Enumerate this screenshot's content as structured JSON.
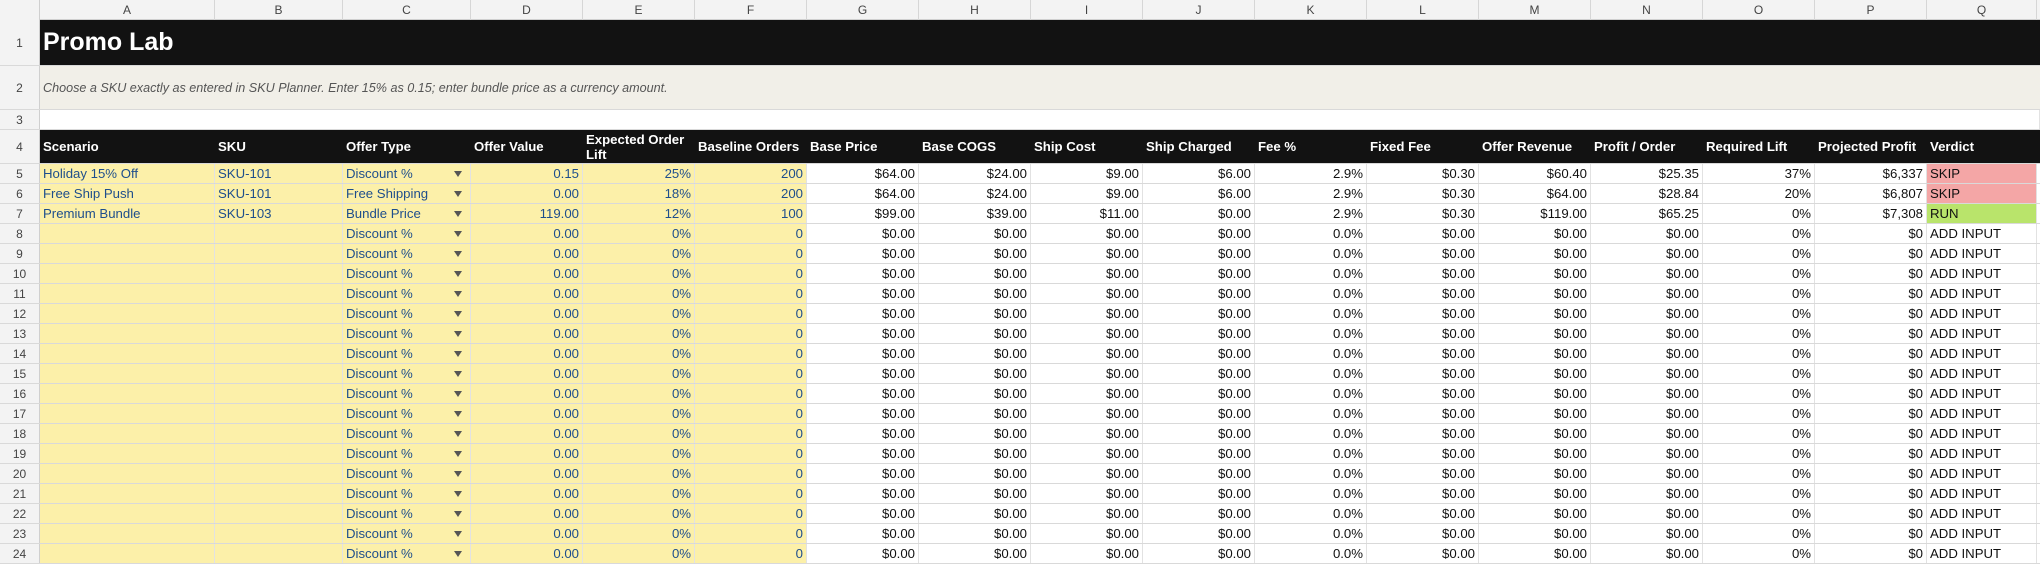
{
  "columns": [
    "A",
    "B",
    "C",
    "D",
    "E",
    "F",
    "G",
    "H",
    "I",
    "J",
    "K",
    "L",
    "M",
    "N",
    "O",
    "P",
    "Q"
  ],
  "title": "Promo Lab",
  "instructions": "Choose a SKU exactly as entered in SKU Planner. Enter 15% as 0.15; enter bundle price as a currency amount.",
  "headers": [
    "Scenario",
    "SKU",
    "Offer Type",
    "Offer Value",
    "Expected Order Lift",
    "Baseline Orders",
    "Base Price",
    "Base COGS",
    "Ship Cost",
    "Ship Charged",
    "Fee %",
    "Fixed Fee",
    "Offer Revenue",
    "Profit / Order",
    "Required Lift",
    "Projected Profit",
    "Verdict"
  ],
  "data_rows": [
    {
      "row": "5",
      "cells": [
        "Holiday 15% Off",
        "SKU-101",
        "Discount %",
        "0.15",
        "25%",
        "200",
        "$64.00",
        "$24.00",
        "$9.00",
        "$6.00",
        "2.9%",
        "$0.30",
        "$60.40",
        "$25.35",
        "37%",
        "$6,337",
        "SKIP"
      ],
      "verdict_color": "#f4a6a6"
    },
    {
      "row": "6",
      "cells": [
        "Free Ship Push",
        "SKU-101",
        "Free Shipping",
        "0.00",
        "18%",
        "200",
        "$64.00",
        "$24.00",
        "$9.00",
        "$6.00",
        "2.9%",
        "$0.30",
        "$64.00",
        "$28.84",
        "20%",
        "$6,807",
        "SKIP"
      ],
      "verdict_color": "#f4a6a6"
    },
    {
      "row": "7",
      "cells": [
        "Premium Bundle",
        "SKU-103",
        "Bundle Price",
        "119.00",
        "12%",
        "100",
        "$99.00",
        "$39.00",
        "$11.00",
        "$0.00",
        "2.9%",
        "$0.30",
        "$119.00",
        "$65.25",
        "0%",
        "$7,308",
        "RUN"
      ],
      "verdict_color": "#b9e46b"
    },
    {
      "row": "8",
      "cells": [
        "",
        "",
        "Discount %",
        "0.00",
        "0%",
        "0",
        "$0.00",
        "$0.00",
        "$0.00",
        "$0.00",
        "0.0%",
        "$0.00",
        "$0.00",
        "$0.00",
        "0%",
        "$0",
        "ADD INPUT"
      ]
    },
    {
      "row": "9",
      "cells": [
        "",
        "",
        "Discount %",
        "0.00",
        "0%",
        "0",
        "$0.00",
        "$0.00",
        "$0.00",
        "$0.00",
        "0.0%",
        "$0.00",
        "$0.00",
        "$0.00",
        "0%",
        "$0",
        "ADD INPUT"
      ]
    },
    {
      "row": "10",
      "cells": [
        "",
        "",
        "Discount %",
        "0.00",
        "0%",
        "0",
        "$0.00",
        "$0.00",
        "$0.00",
        "$0.00",
        "0.0%",
        "$0.00",
        "$0.00",
        "$0.00",
        "0%",
        "$0",
        "ADD INPUT"
      ]
    },
    {
      "row": "11",
      "cells": [
        "",
        "",
        "Discount %",
        "0.00",
        "0%",
        "0",
        "$0.00",
        "$0.00",
        "$0.00",
        "$0.00",
        "0.0%",
        "$0.00",
        "$0.00",
        "$0.00",
        "0%",
        "$0",
        "ADD INPUT"
      ]
    },
    {
      "row": "12",
      "cells": [
        "",
        "",
        "Discount %",
        "0.00",
        "0%",
        "0",
        "$0.00",
        "$0.00",
        "$0.00",
        "$0.00",
        "0.0%",
        "$0.00",
        "$0.00",
        "$0.00",
        "0%",
        "$0",
        "ADD INPUT"
      ]
    },
    {
      "row": "13",
      "cells": [
        "",
        "",
        "Discount %",
        "0.00",
        "0%",
        "0",
        "$0.00",
        "$0.00",
        "$0.00",
        "$0.00",
        "0.0%",
        "$0.00",
        "$0.00",
        "$0.00",
        "0%",
        "$0",
        "ADD INPUT"
      ]
    },
    {
      "row": "14",
      "cells": [
        "",
        "",
        "Discount %",
        "0.00",
        "0%",
        "0",
        "$0.00",
        "$0.00",
        "$0.00",
        "$0.00",
        "0.0%",
        "$0.00",
        "$0.00",
        "$0.00",
        "0%",
        "$0",
        "ADD INPUT"
      ]
    },
    {
      "row": "15",
      "cells": [
        "",
        "",
        "Discount %",
        "0.00",
        "0%",
        "0",
        "$0.00",
        "$0.00",
        "$0.00",
        "$0.00",
        "0.0%",
        "$0.00",
        "$0.00",
        "$0.00",
        "0%",
        "$0",
        "ADD INPUT"
      ]
    },
    {
      "row": "16",
      "cells": [
        "",
        "",
        "Discount %",
        "0.00",
        "0%",
        "0",
        "$0.00",
        "$0.00",
        "$0.00",
        "$0.00",
        "0.0%",
        "$0.00",
        "$0.00",
        "$0.00",
        "0%",
        "$0",
        "ADD INPUT"
      ]
    },
    {
      "row": "17",
      "cells": [
        "",
        "",
        "Discount %",
        "0.00",
        "0%",
        "0",
        "$0.00",
        "$0.00",
        "$0.00",
        "$0.00",
        "0.0%",
        "$0.00",
        "$0.00",
        "$0.00",
        "0%",
        "$0",
        "ADD INPUT"
      ]
    },
    {
      "row": "18",
      "cells": [
        "",
        "",
        "Discount %",
        "0.00",
        "0%",
        "0",
        "$0.00",
        "$0.00",
        "$0.00",
        "$0.00",
        "0.0%",
        "$0.00",
        "$0.00",
        "$0.00",
        "0%",
        "$0",
        "ADD INPUT"
      ]
    },
    {
      "row": "19",
      "cells": [
        "",
        "",
        "Discount %",
        "0.00",
        "0%",
        "0",
        "$0.00",
        "$0.00",
        "$0.00",
        "$0.00",
        "0.0%",
        "$0.00",
        "$0.00",
        "$0.00",
        "0%",
        "$0",
        "ADD INPUT"
      ]
    },
    {
      "row": "20",
      "cells": [
        "",
        "",
        "Discount %",
        "0.00",
        "0%",
        "0",
        "$0.00",
        "$0.00",
        "$0.00",
        "$0.00",
        "0.0%",
        "$0.00",
        "$0.00",
        "$0.00",
        "0%",
        "$0",
        "ADD INPUT"
      ]
    },
    {
      "row": "21",
      "cells": [
        "",
        "",
        "Discount %",
        "0.00",
        "0%",
        "0",
        "$0.00",
        "$0.00",
        "$0.00",
        "$0.00",
        "0.0%",
        "$0.00",
        "$0.00",
        "$0.00",
        "0%",
        "$0",
        "ADD INPUT"
      ]
    },
    {
      "row": "22",
      "cells": [
        "",
        "",
        "Discount %",
        "0.00",
        "0%",
        "0",
        "$0.00",
        "$0.00",
        "$0.00",
        "$0.00",
        "0.0%",
        "$0.00",
        "$0.00",
        "$0.00",
        "0%",
        "$0",
        "ADD INPUT"
      ]
    },
    {
      "row": "23",
      "cells": [
        "",
        "",
        "Discount %",
        "0.00",
        "0%",
        "0",
        "$0.00",
        "$0.00",
        "$0.00",
        "$0.00",
        "0.0%",
        "$0.00",
        "$0.00",
        "$0.00",
        "0%",
        "$0",
        "ADD INPUT"
      ]
    },
    {
      "row": "24",
      "cells": [
        "",
        "",
        "Discount %",
        "0.00",
        "0%",
        "0",
        "$0.00",
        "$0.00",
        "$0.00",
        "$0.00",
        "0.0%",
        "$0.00",
        "$0.00",
        "$0.00",
        "0%",
        "$0",
        "ADD INPUT"
      ]
    }
  ],
  "colors": {
    "title_bg": "#121212",
    "input_bg": "#fcf0a9",
    "input_text": "#1e4e8c",
    "skip": "#f4a6a6",
    "run": "#b9e46b",
    "note_bg": "#f1efe8"
  }
}
